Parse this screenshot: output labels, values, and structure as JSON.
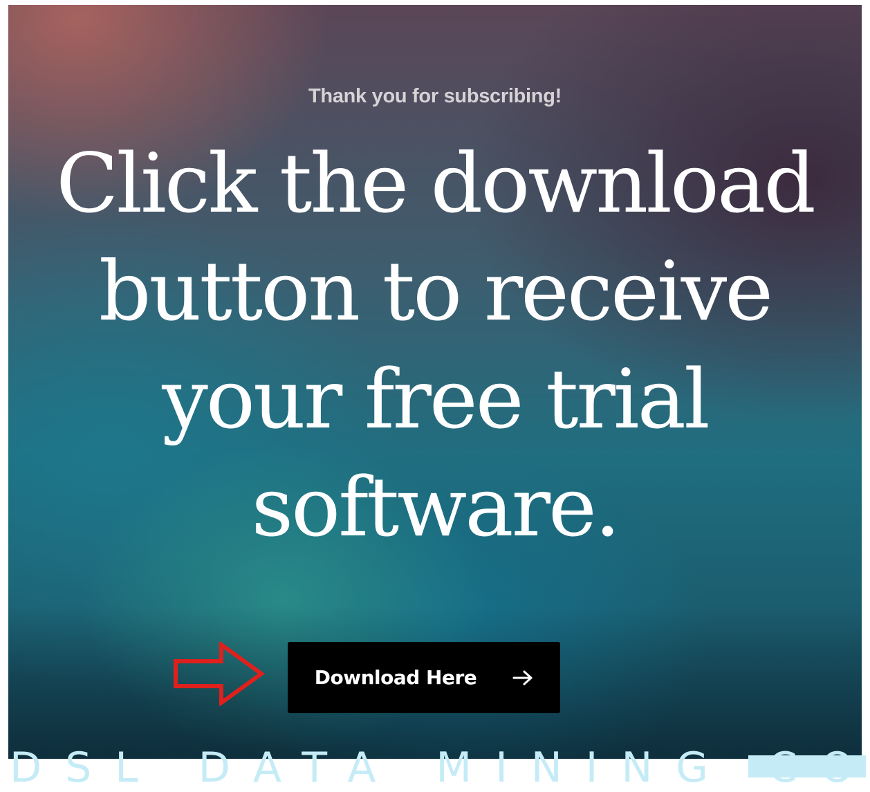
{
  "hero": {
    "subtitle": "Thank you for subscribing!",
    "headline_lines": [
      "Click the download",
      "button to receive",
      "your free trial",
      "software."
    ]
  },
  "download": {
    "label": "Download Here",
    "icon": "arrow-right-icon"
  },
  "annotation": {
    "icon": "pointer-arrow-icon",
    "color": "#e0201c"
  },
  "watermark": {
    "text": "DSL DATA MINING CO."
  },
  "colors": {
    "button_bg": "#000000",
    "button_text": "#ffffff",
    "watermark": "#c5ecf6"
  }
}
